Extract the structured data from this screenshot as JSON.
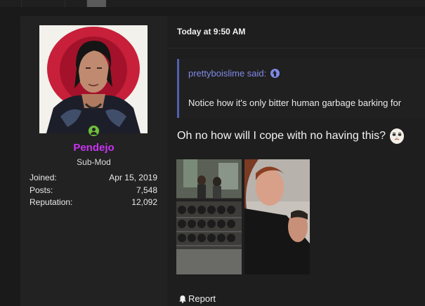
{
  "user": {
    "username": "Pendejo",
    "title": "Sub-Mod",
    "stats": [
      {
        "label": "Joined:",
        "value": "Apr 15, 2019"
      },
      {
        "label": "Posts:",
        "value": "7,548"
      },
      {
        "label": "Reputation:",
        "value": "12,092"
      }
    ],
    "online_icon": "online-user-icon",
    "colors": {
      "username": "#c933f2",
      "online": "#6fbf3f"
    }
  },
  "post": {
    "date": "Today at 9:50 AM",
    "quote": {
      "author": "prettyboislime said:",
      "text": "Notice how it's only bitter human garbage barking for",
      "arrow_icon": "arrow-up-circle-icon"
    },
    "message": "Oh no how will I cope with no having this?",
    "report_label": "Report",
    "colors": {
      "quote_accent": "#5060b0",
      "quote_author": "#7f8ae6"
    }
  }
}
